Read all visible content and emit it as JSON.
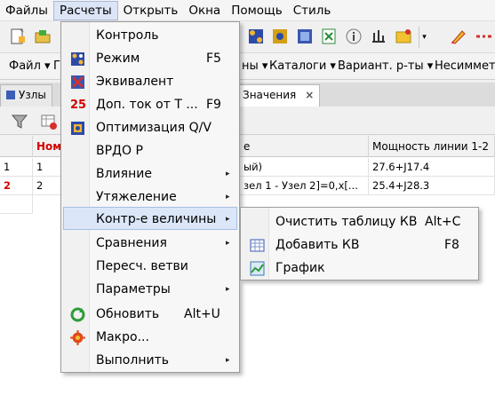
{
  "menubar": {
    "items": [
      "Файлы",
      "Расчеты",
      "Открыть",
      "Окна",
      "Помощь",
      "Стиль"
    ]
  },
  "toolbar2": {
    "file_label": "Файл",
    "file_partial": "Г",
    "partial_1": "ны",
    "catalogs": "Каталоги",
    "variants": "Вариант. р-ты",
    "mismatch": "Несиммет"
  },
  "tabs": {
    "nodes": "Узлы",
    "values": "Значения",
    "close_glyph": "×"
  },
  "grid": {
    "headers": [
      "",
      "Ном",
      "е",
      "Мощность линии 1-2"
    ],
    "rows": [
      [
        "1",
        "1",
        "ый)",
        "27.6+J17.4"
      ],
      [
        "2",
        "2",
        "зел 1 - Узел 2]=0,x[...",
        "25.4+J28.3"
      ]
    ]
  },
  "menu": {
    "items": [
      {
        "label": "Контроль",
        "shortcut": "",
        "submenu": false,
        "icon": "control-icon"
      },
      {
        "label": "Режим",
        "shortcut": "F5",
        "submenu": false,
        "icon": "mode-icon"
      },
      {
        "label": "Эквивалент",
        "shortcut": "",
        "submenu": false,
        "icon": "equivalent-icon"
      },
      {
        "label": "Доп. ток от Т ...",
        "shortcut": "F9",
        "submenu": false,
        "icon": "current-25-icon"
      },
      {
        "label": "Оптимизация Q/V",
        "shortcut": "",
        "submenu": false,
        "icon": "optimization-icon"
      },
      {
        "label": "ВРДО Р",
        "shortcut": "",
        "submenu": false,
        "icon": ""
      },
      {
        "label": "Влияние",
        "shortcut": "",
        "submenu": true,
        "icon": ""
      },
      {
        "label": "Утяжеление",
        "shortcut": "",
        "submenu": true,
        "icon": ""
      },
      {
        "label": "Контр-е величины",
        "shortcut": "",
        "submenu": true,
        "icon": ""
      },
      {
        "label": "Сравнения",
        "shortcut": "",
        "submenu": true,
        "icon": ""
      },
      {
        "label": "Пересч. ветви",
        "shortcut": "",
        "submenu": false,
        "icon": ""
      },
      {
        "label": "Параметры",
        "shortcut": "",
        "submenu": true,
        "icon": ""
      },
      {
        "label": "Обновить",
        "shortcut": "Alt+U",
        "submenu": false,
        "icon": "refresh-icon"
      },
      {
        "label": "Макро...",
        "shortcut": "",
        "submenu": false,
        "icon": "macro-icon"
      },
      {
        "label": "Выполнить",
        "shortcut": "",
        "submenu": true,
        "icon": ""
      }
    ],
    "arrow_glyph": "▸"
  },
  "submenu": {
    "items": [
      {
        "label": "Очистить таблицу КВ",
        "shortcut": "Alt+C",
        "icon": ""
      },
      {
        "label": "Добавить КВ",
        "shortcut": "F8",
        "icon": "add-table-icon"
      },
      {
        "label": "График",
        "shortcut": "",
        "icon": "chart-icon"
      }
    ]
  },
  "colors": {
    "accent_red": "#d40000",
    "highlight": "#dbe7f8"
  }
}
